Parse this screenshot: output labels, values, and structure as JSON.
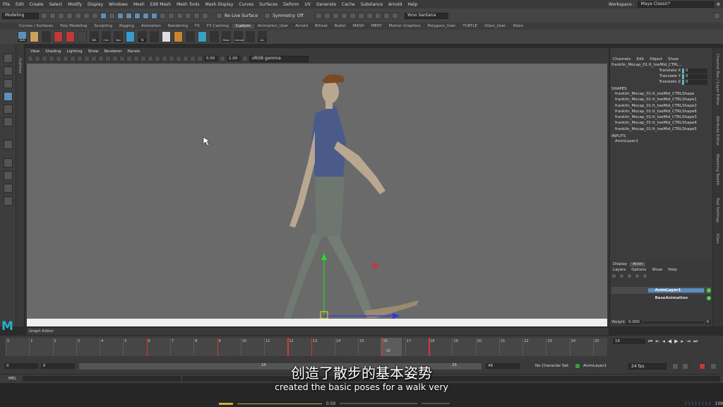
{
  "menubar": {
    "items": [
      "File",
      "Edit",
      "Create",
      "Select",
      "Modify",
      "Display",
      "Windows",
      "Mesh",
      "Edit Mesh",
      "Mesh Tools",
      "Mesh Display",
      "Curves",
      "Surfaces",
      "Deform",
      "UV",
      "Generate",
      "Cache",
      "Substance",
      "Arnold",
      "Help"
    ],
    "workspace_label": "Workspace :",
    "workspace_value": "Maya Classic*"
  },
  "statusline": {
    "mode": "Modeling",
    "live_surface": "No Live Surface",
    "symmetry": "Symmetry: Off",
    "user": "Yono Santana"
  },
  "shelf": {
    "tabs": [
      "Curves / Surfaces",
      "Poly Modeling",
      "Sculpting",
      "Rigging",
      "Animation",
      "Rendering",
      "FX",
      "FX Caching",
      "Custom",
      "Animation_User",
      "Arnold",
      "Bifrost",
      "Bullet",
      "MASH",
      "MERY",
      "Motion Graphics",
      "Polygons_User",
      "TURTLE",
      "XGen_User",
      "XGen"
    ],
    "active_tab": "Custom",
    "button_labels": [
      "ALN",
      "",
      "",
      "",
      "",
      "",
      "DEL",
      "Chin",
      "Hair",
      "",
      "TK",
      "",
      "",
      "",
      "",
      "",
      "",
      "Mute",
      "Unmut",
      "",
      "ALL"
    ]
  },
  "side_labels": {
    "outliner": "Outliner",
    "channel_box": "Channel Box / Layer Editor",
    "attribute_editor": "Attribute Editor",
    "modeling_toolkit": "Modeling Toolkit",
    "tool_settings": "Tool Settings",
    "xgen": "XGen"
  },
  "panel": {
    "menus": [
      "View",
      "Shading",
      "Lighting",
      "Show",
      "Renderer",
      "Panels"
    ],
    "value1": "0.00",
    "value2": "1.00",
    "color_space": "sRGB gamma"
  },
  "channel_box": {
    "menus": [
      "Channels",
      "Edit",
      "Object",
      "Show"
    ],
    "object_name": "franklin_Mocap_01:lt_toeMid_CTRL...",
    "attributes": [
      {
        "name": "Translate X",
        "value": "0"
      },
      {
        "name": "Translate Y",
        "value": "0"
      },
      {
        "name": "Translate Z",
        "value": "0"
      }
    ],
    "shapes_header": "SHAPES",
    "shapes": [
      "franklin_Mocap_01:lt_toeMid_CTRLShape",
      "franklin_Mocap_01:lt_toeMid_CTRLShape1",
      "franklin_Mocap_01:lt_toeMid_CTRLShape2",
      "franklin_Mocap_01:lt_toeMid_CTRLShape6",
      "franklin_Mocap_01:lt_toeMid_CTRLShape3",
      "franklin_Mocap_01:lt_toeMid_CTRLShape4",
      "franklin_Mocap_01:lt_toeMid_CTRLShape5"
    ],
    "inputs_header": "INPUTS",
    "inputs": [
      "AnimLayer1"
    ]
  },
  "layer_editor": {
    "tabs": [
      "Display",
      "Anim"
    ],
    "active_tab": "Anim",
    "menus": [
      "Layers",
      "Options",
      "Show",
      "Help"
    ],
    "layers": [
      "AnimLayer1",
      "BaseAnimation"
    ],
    "weight_label": "Weight",
    "weight_value": "0.000",
    "key_label": "K"
  },
  "graph_editor_label": "Graph Editor",
  "timeline": {
    "tick_labels": [
      "0",
      "1",
      "2",
      "3",
      "4",
      "5",
      "6",
      "7",
      "8",
      "9",
      "10",
      "11",
      "12",
      "13",
      "14",
      "15",
      "16",
      "17",
      "18",
      "19",
      "20",
      "21",
      "22",
      "23",
      "24",
      "25"
    ],
    "key_frames": [
      6,
      9,
      12,
      13,
      16,
      18
    ],
    "current_frame": "16",
    "current_frame_field": "16"
  },
  "range": {
    "start": "0",
    "anim_start": "0",
    "range_label_left": "25",
    "range_label_right": "25",
    "end": "48",
    "character_set": "No Character Set",
    "anim_layer": "AnimLayer1",
    "fps": "24 fps"
  },
  "mel_label": "MEL",
  "subtitles": {
    "chinese": "创造了散步的基本姿势",
    "english": "created the basic poses for a walk very"
  },
  "bottom": {
    "value": "0.50",
    "count": "109"
  }
}
